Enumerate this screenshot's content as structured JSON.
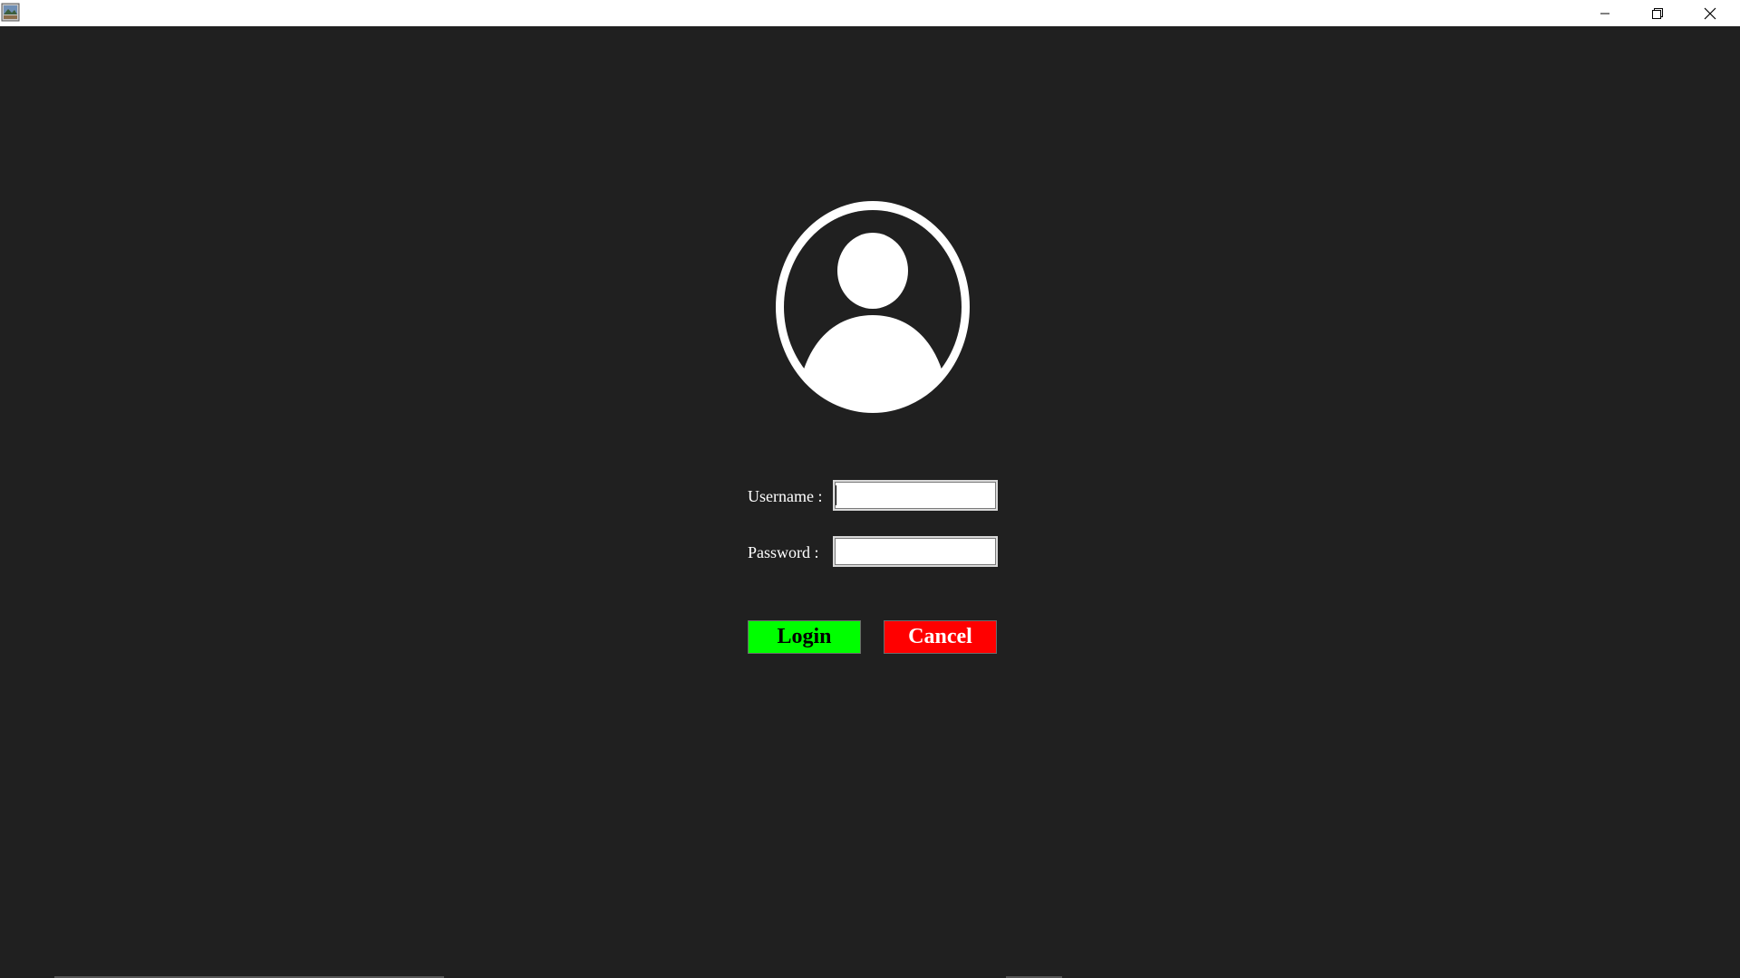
{
  "window": {
    "icons": {
      "app": "java-app-icon",
      "minimize": "minimize-icon",
      "maximize": "restore-icon",
      "close": "close-icon"
    }
  },
  "login_form": {
    "username_label": "Username :",
    "password_label": "Password :",
    "username_value": "",
    "password_value": "",
    "login_button": "Login",
    "cancel_button": "Cancel",
    "avatar_icon": "user-avatar-icon"
  },
  "colors": {
    "background": "#202020",
    "login_button_bg": "#00ff00",
    "cancel_button_bg": "#ff0000",
    "label_text": "#ffffff"
  }
}
